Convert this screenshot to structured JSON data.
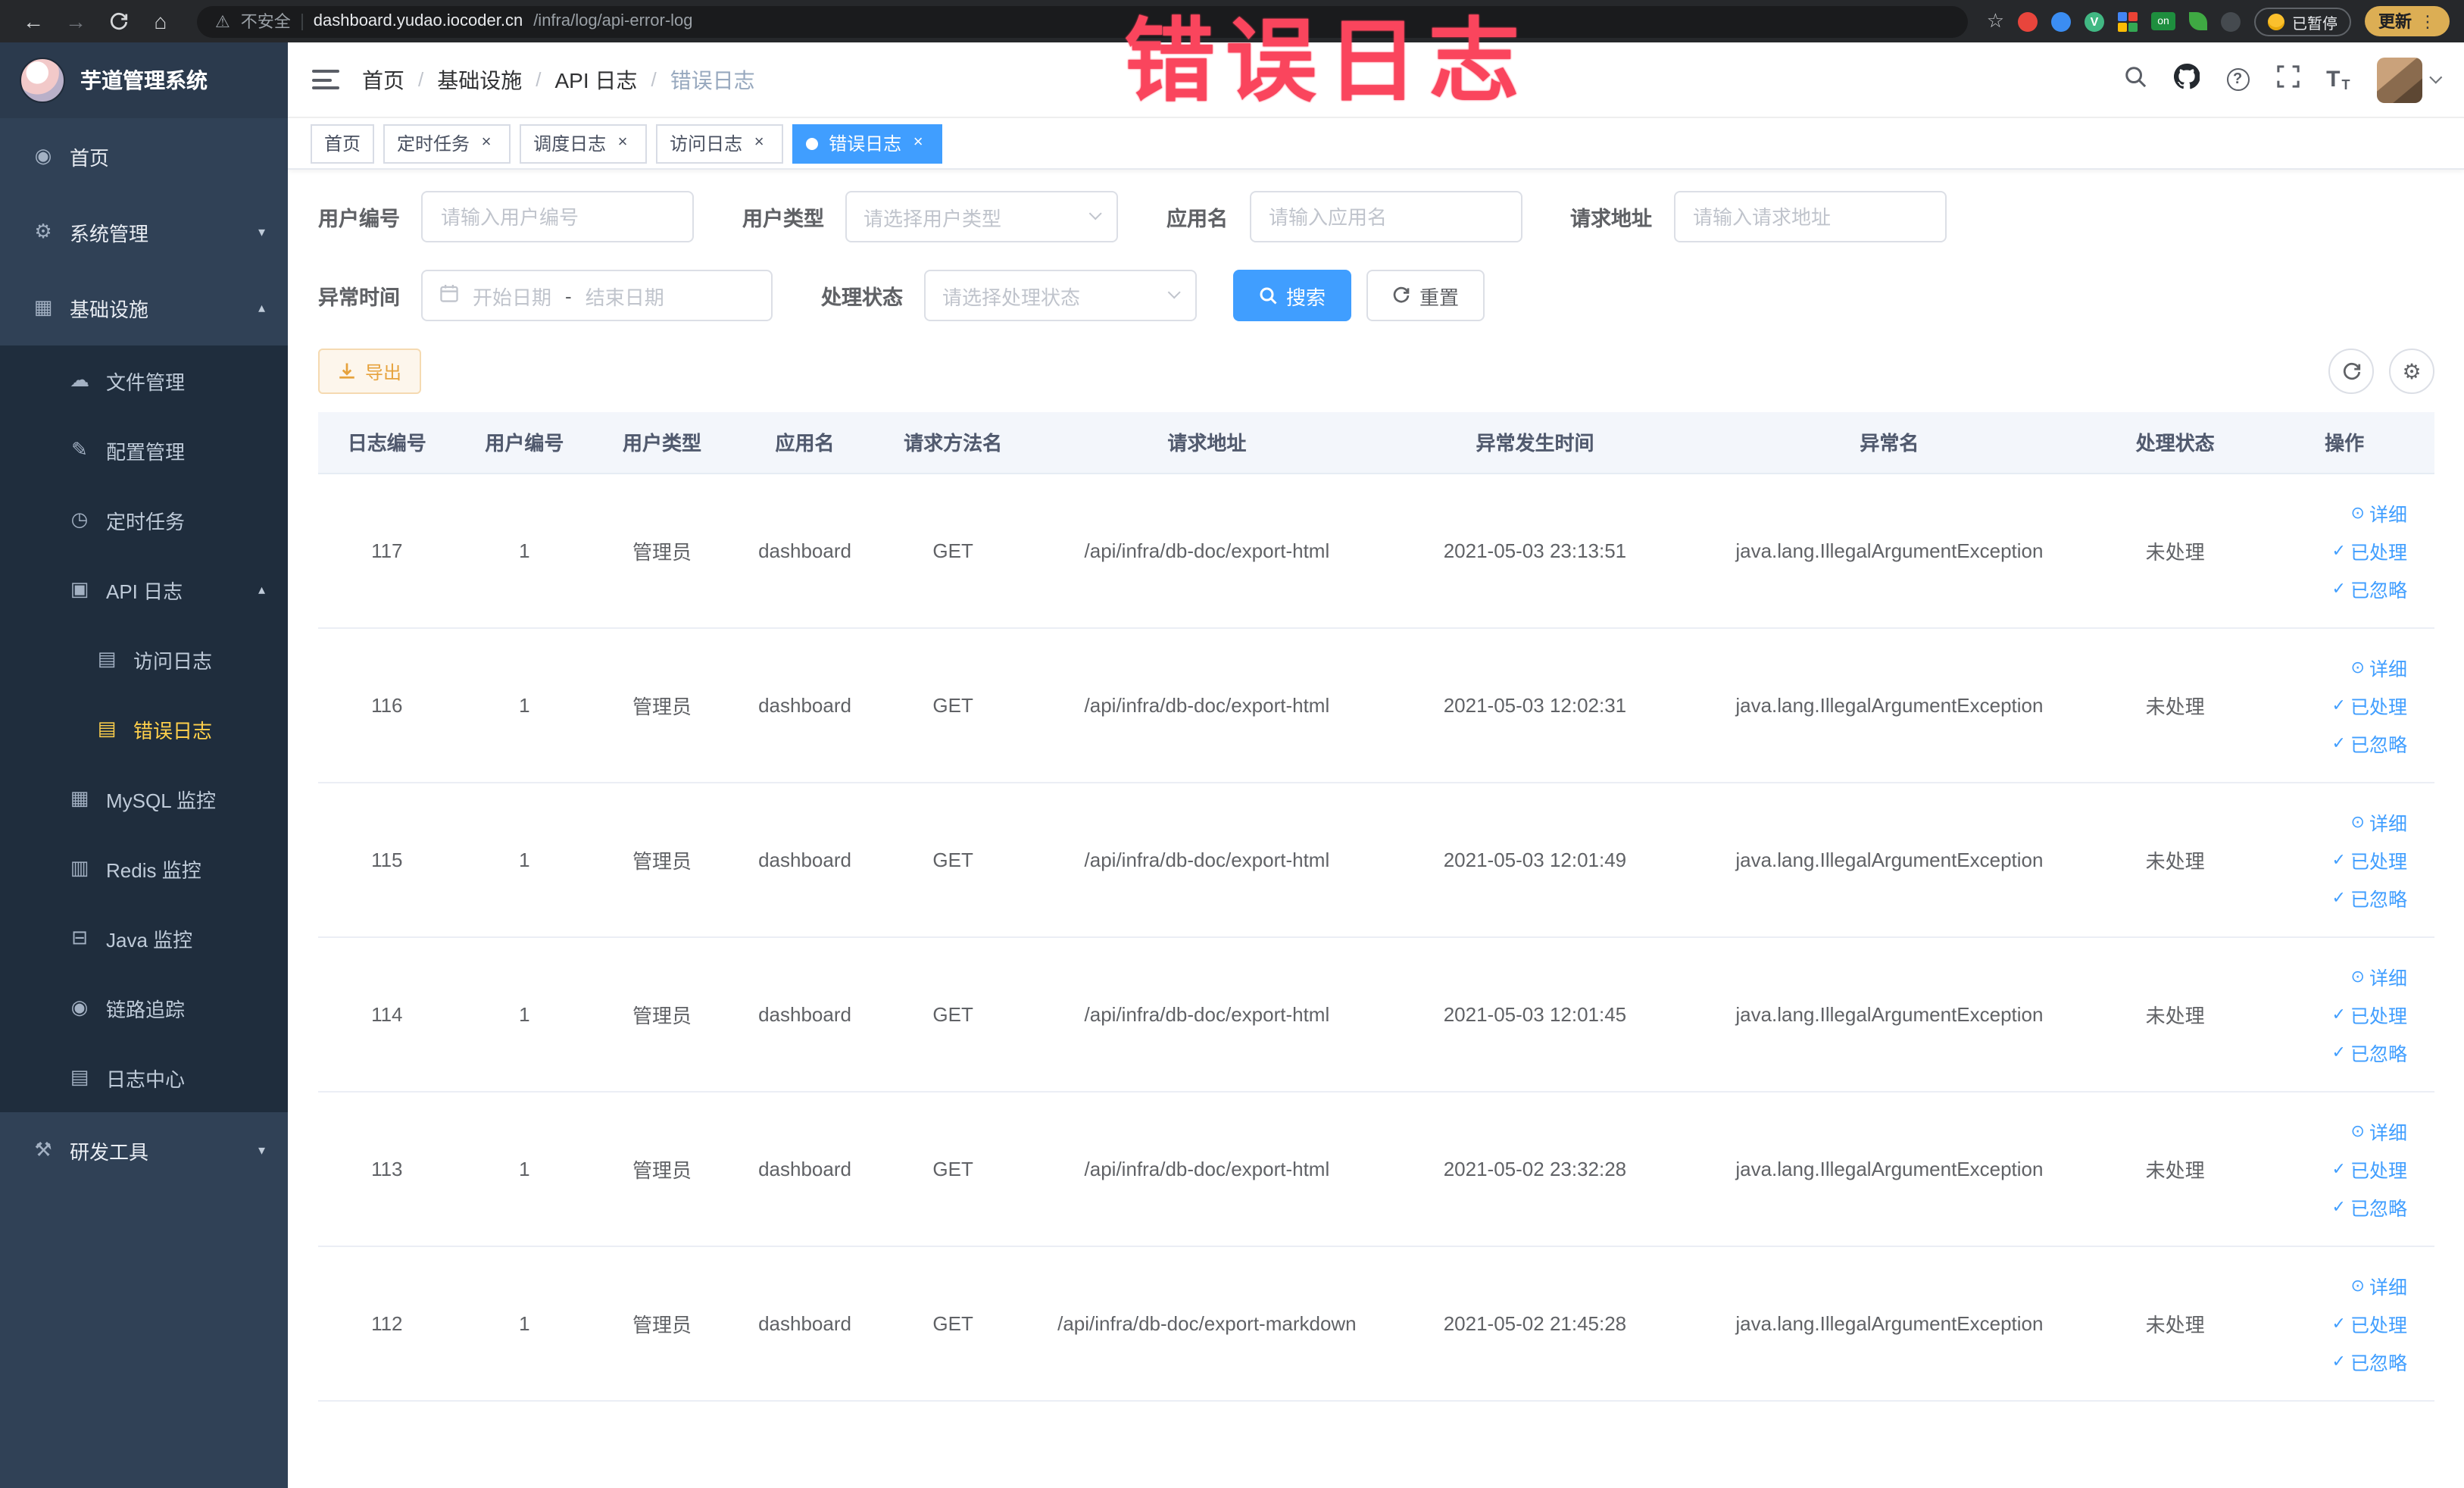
{
  "colors": {
    "primary": "#409eff",
    "sidebar_bg": "#304156",
    "submenu_bg": "#1f2d3d",
    "menu_active_text": "#ffd04b",
    "tag_active_bg": "#409eff",
    "export_text": "#e6a23c",
    "watermark": "#fa455d"
  },
  "watermark_text": "错误日志",
  "browser": {
    "not_secure_label": "不安全",
    "url_host": "dashboard.yudao.iocoder.cn",
    "url_path": "/infra/log/api-error-log",
    "vue_badge_label": "V",
    "extension_on_label": "on",
    "paused_badge": "已暂停",
    "update_button": "更新",
    "menu_dots": "⋮"
  },
  "sidebar": {
    "logo_title": "芋道管理系统",
    "items": [
      {
        "label": "首页",
        "icon": "dashboard-icon",
        "level": 1
      },
      {
        "label": "系统管理",
        "icon": "gear-icon",
        "level": 1,
        "arrow": "down"
      },
      {
        "label": "基础设施",
        "icon": "infra-icon",
        "level": 1,
        "arrow": "up"
      },
      {
        "label": "文件管理",
        "icon": "file-icon",
        "level": 2
      },
      {
        "label": "配置管理",
        "icon": "config-icon",
        "level": 2
      },
      {
        "label": "定时任务",
        "icon": "job-icon",
        "level": 2
      },
      {
        "label": "API 日志",
        "icon": "api-log-icon",
        "level": 2,
        "arrow": "up"
      },
      {
        "label": "访问日志",
        "icon": "access-log-icon",
        "level": 3
      },
      {
        "label": "错误日志",
        "icon": "error-log-icon",
        "level": 3,
        "active": true
      },
      {
        "label": "MySQL 监控",
        "icon": "mysql-icon",
        "level": 2
      },
      {
        "label": "Redis 监控",
        "icon": "redis-icon",
        "level": 2
      },
      {
        "label": "Java 监控",
        "icon": "java-icon",
        "level": 2
      },
      {
        "label": "链路追踪",
        "icon": "trace-icon",
        "level": 2
      },
      {
        "label": "日志中心",
        "icon": "log-center-icon",
        "level": 2
      },
      {
        "label": "研发工具",
        "icon": "tool-icon",
        "level": 1,
        "arrow": "down"
      }
    ]
  },
  "navbar": {
    "breadcrumb": [
      "首页",
      "基础设施",
      "API 日志",
      "错误日志"
    ],
    "breadcrumb_separator": "/"
  },
  "tags": [
    {
      "label": "首页"
    },
    {
      "label": "定时任务",
      "closable": true
    },
    {
      "label": "调度日志",
      "closable": true
    },
    {
      "label": "访问日志",
      "closable": true
    },
    {
      "label": "错误日志",
      "closable": true,
      "active": true
    }
  ],
  "filters": {
    "user_id_label": "用户编号",
    "user_id_placeholder": "请输入用户编号",
    "user_type_label": "用户类型",
    "user_type_placeholder": "请选择用户类型",
    "app_name_label": "应用名",
    "app_name_placeholder": "请输入应用名",
    "request_url_label": "请求地址",
    "request_url_placeholder": "请输入请求地址",
    "exception_time_label": "异常时间",
    "date_start_placeholder": "开始日期",
    "date_separator": "-",
    "date_end_placeholder": "结束日期",
    "process_status_label": "处理状态",
    "process_status_placeholder": "请选择处理状态",
    "search_button": "搜索",
    "reset_button": "重置"
  },
  "toolbar": {
    "export_button": "导出"
  },
  "table": {
    "columns": [
      "日志编号",
      "用户编号",
      "用户类型",
      "应用名",
      "请求方法名",
      "请求地址",
      "异常发生时间",
      "异常名",
      "处理状态",
      "操作"
    ],
    "actions": [
      "详细",
      "已处理",
      "已忽略"
    ],
    "rows": [
      {
        "id": "117",
        "user_id": "1",
        "user_type": "管理员",
        "app_name": "dashboard",
        "method": "GET",
        "url": "/api/infra/db-doc/export-html",
        "time": "2021-05-03 23:13:51",
        "exception": "java.lang.IllegalArgumentException",
        "status": "未处理"
      },
      {
        "id": "116",
        "user_id": "1",
        "user_type": "管理员",
        "app_name": "dashboard",
        "method": "GET",
        "url": "/api/infra/db-doc/export-html",
        "time": "2021-05-03 12:02:31",
        "exception": "java.lang.IllegalArgumentException",
        "status": "未处理"
      },
      {
        "id": "115",
        "user_id": "1",
        "user_type": "管理员",
        "app_name": "dashboard",
        "method": "GET",
        "url": "/api/infra/db-doc/export-html",
        "time": "2021-05-03 12:01:49",
        "exception": "java.lang.IllegalArgumentException",
        "status": "未处理"
      },
      {
        "id": "114",
        "user_id": "1",
        "user_type": "管理员",
        "app_name": "dashboard",
        "method": "GET",
        "url": "/api/infra/db-doc/export-html",
        "time": "2021-05-03 12:01:45",
        "exception": "java.lang.IllegalArgumentException",
        "status": "未处理"
      },
      {
        "id": "113",
        "user_id": "1",
        "user_type": "管理员",
        "app_name": "dashboard",
        "method": "GET",
        "url": "/api/infra/db-doc/export-html",
        "time": "2021-05-02 23:32:28",
        "exception": "java.lang.IllegalArgumentException",
        "status": "未处理"
      },
      {
        "id": "112",
        "user_id": "1",
        "user_type": "管理员",
        "app_name": "dashboard",
        "method": "GET",
        "url": "/api/infra/db-doc/export-markdown",
        "time": "2021-05-02 21:45:28",
        "exception": "java.lang.IllegalArgumentException",
        "status": "未处理"
      }
    ]
  }
}
